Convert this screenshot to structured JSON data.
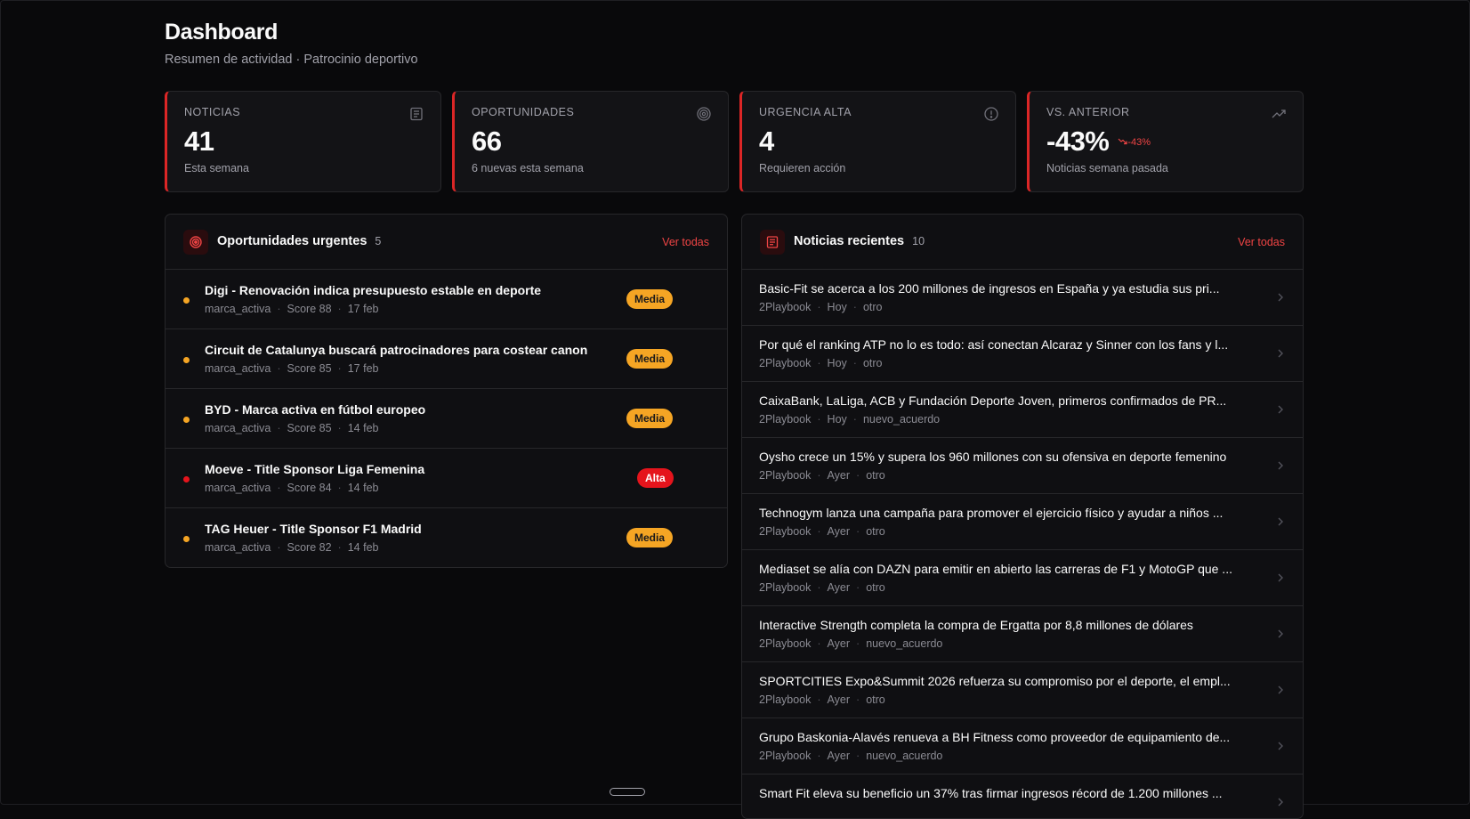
{
  "header": {
    "title": "Dashboard",
    "subtitle": "Resumen de actividad · Patrocinio deportivo"
  },
  "stats": [
    {
      "label": "NOTICIAS",
      "value": "41",
      "caption": "Esta semana",
      "icon": "newspaper-icon"
    },
    {
      "label": "OPORTUNIDADES",
      "value": "66",
      "caption": "6 nuevas esta semana",
      "icon": "target-icon"
    },
    {
      "label": "URGENCIA ALTA",
      "value": "4",
      "caption": "Requieren acción",
      "icon": "alert-circle-icon"
    },
    {
      "label": "VS. ANTERIOR",
      "value": "-43%",
      "trend": "-43%",
      "caption": "Noticias semana pasada",
      "icon": "trending-up-icon"
    }
  ],
  "opportunities": {
    "title": "Oportunidades urgentes",
    "count": "5",
    "link": "Ver todas",
    "items": [
      {
        "title": "Digi - Renovación indica presupuesto estable en deporte",
        "source": "marca_activa",
        "score": "Score 88",
        "date": "17 feb",
        "badge": "Media",
        "level": "media"
      },
      {
        "title": "Circuit de Catalunya buscará patrocinadores para costear canon",
        "source": "marca_activa",
        "score": "Score 85",
        "date": "17 feb",
        "badge": "Media",
        "level": "media"
      },
      {
        "title": "BYD - Marca activa en fútbol europeo",
        "source": "marca_activa",
        "score": "Score 85",
        "date": "14 feb",
        "badge": "Media",
        "level": "media"
      },
      {
        "title": "Moeve - Title Sponsor Liga Femenina",
        "source": "marca_activa",
        "score": "Score 84",
        "date": "14 feb",
        "badge": "Alta",
        "level": "alta"
      },
      {
        "title": "TAG Heuer - Title Sponsor F1 Madrid",
        "source": "marca_activa",
        "score": "Score 82",
        "date": "14 feb",
        "badge": "Media",
        "level": "media"
      }
    ]
  },
  "news": {
    "title": "Noticias recientes",
    "count": "10",
    "link": "Ver todas",
    "items": [
      {
        "title": "Basic-Fit se acerca a los 200 millones de ingresos en España y ya estudia sus pri...",
        "source": "2Playbook",
        "when": "Hoy",
        "tag": "otro"
      },
      {
        "title": "Por qué el ranking ATP no lo es todo: así conectan Alcaraz y Sinner con los fans y l...",
        "source": "2Playbook",
        "when": "Hoy",
        "tag": "otro"
      },
      {
        "title": "CaixaBank, LaLiga, ACB y Fundación Deporte Joven, primeros confirmados de PR...",
        "source": "2Playbook",
        "when": "Hoy",
        "tag": "nuevo_acuerdo"
      },
      {
        "title": "Oysho crece un 15% y supera los 960 millones con su ofensiva en deporte femenino",
        "source": "2Playbook",
        "when": "Ayer",
        "tag": "otro"
      },
      {
        "title": "Technogym lanza una campaña para promover el ejercicio físico y ayudar a niños ...",
        "source": "2Playbook",
        "when": "Ayer",
        "tag": "otro"
      },
      {
        "title": "Mediaset se alía con DAZN para emitir en abierto las carreras de F1 y MotoGP que ...",
        "source": "2Playbook",
        "when": "Ayer",
        "tag": "otro"
      },
      {
        "title": "Interactive Strength completa la compra de Ergatta por 8,8 millones de dólares",
        "source": "2Playbook",
        "when": "Ayer",
        "tag": "nuevo_acuerdo"
      },
      {
        "title": "SPORTCITIES Expo&Summit 2026 refuerza su compromiso por el deporte, el empl...",
        "source": "2Playbook",
        "when": "Ayer",
        "tag": "otro"
      },
      {
        "title": "Grupo Baskonia-Alavés renueva a BH Fitness como proveedor de equipamiento de...",
        "source": "2Playbook",
        "when": "Ayer",
        "tag": "nuevo_acuerdo"
      },
      {
        "title": "Smart Fit eleva su beneficio un 37% tras firmar ingresos récord de 1.200 millones ...",
        "source": "2Playbook",
        "when": "",
        "tag": ""
      }
    ]
  },
  "colors": {
    "accent": "#dc2626",
    "media": "#f5a524",
    "alta": "#e5141c"
  }
}
